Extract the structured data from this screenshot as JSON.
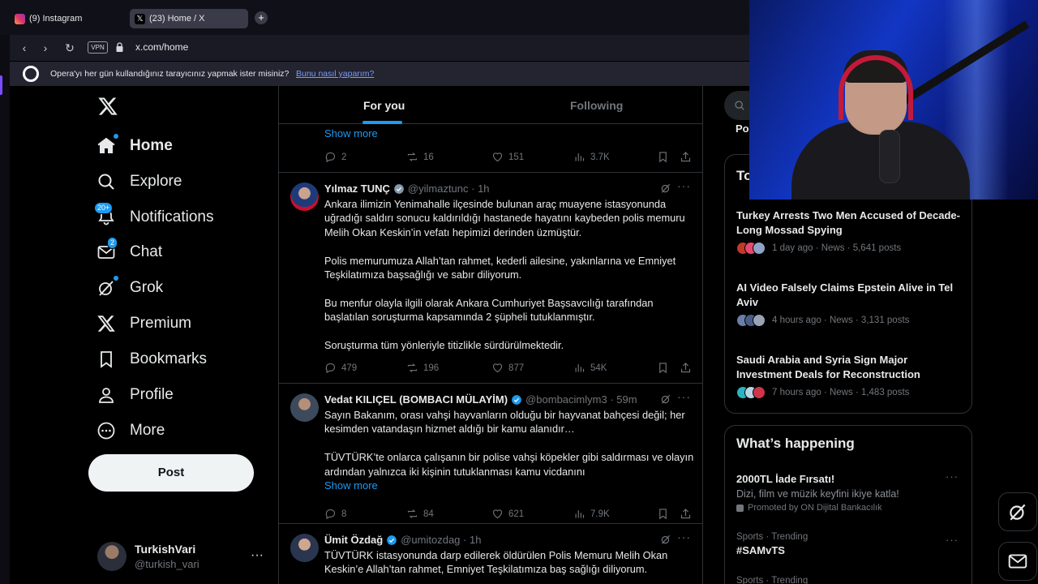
{
  "browser": {
    "tabs": [
      {
        "label": "(9) Instagram",
        "active": false
      },
      {
        "label": "(23) Home / X",
        "active": true
      }
    ],
    "url": "x.com/home",
    "vpn_label": "VPN",
    "opera_prompt": "Opera'yı her gün kullandığınız tarayıcınız yapmak ister misiniz?",
    "opera_link": "Bunu nasıl yaparım?"
  },
  "nav": {
    "items": [
      {
        "label": "Home",
        "icon": "home-icon",
        "badge": ""
      },
      {
        "label": "Explore",
        "icon": "search-icon",
        "badge": ""
      },
      {
        "label": "Notifications",
        "icon": "bell-icon",
        "badge": "20+"
      },
      {
        "label": "Chat",
        "icon": "mail-icon",
        "badge": "2"
      },
      {
        "label": "Grok",
        "icon": "grok-icon",
        "badge": ""
      },
      {
        "label": "Premium",
        "icon": "x-icon",
        "badge": ""
      },
      {
        "label": "Bookmarks",
        "icon": "bookmark-icon",
        "badge": ""
      },
      {
        "label": "Profile",
        "icon": "person-icon",
        "badge": ""
      },
      {
        "label": "More",
        "icon": "more-circle-icon",
        "badge": ""
      }
    ],
    "post_label": "Post",
    "account": {
      "name": "TurkishVari",
      "handle": "@turkish_vari",
      "more": "···"
    }
  },
  "timeline": {
    "tabs": [
      "For you",
      "Following"
    ],
    "active_tab": "For you",
    "first_partial": {
      "show_more": "Show more",
      "stats": {
        "replies": "2",
        "reposts": "16",
        "likes": "151",
        "views": "3.7K"
      }
    },
    "tweets": [
      {
        "name": "Yılmaz TUNÇ",
        "handle": "@yilmaztunc",
        "time": "1h",
        "paragraphs": [
          "Ankara ilimizin Yenimahalle ilçesinde bulunan araç muayene istasyonunda uğradığı saldırı sonucu kaldırıldığı hastanede hayatını kaybeden polis memuru Melih Okan Keskin’in vefatı hepimizi derinden üzmüştür.",
          "Polis memurumuza Allah’tan rahmet, kederli ailesine, yakınlarına ve Emniyet Teşkilatımıza başsağlığı ve sabır diliyorum.",
          "Bu menfur olayla ilgili olarak Ankara Cumhuriyet Başsavcılığı tarafından başlatılan soruşturma kapsamında 2 şüpheli tutuklanmıştır.",
          "Soruşturma tüm yönleriyle titizlikle sürdürülmektedir."
        ],
        "show_more": "",
        "stats": {
          "replies": "479",
          "reposts": "196",
          "likes": "877",
          "views": "54K"
        }
      },
      {
        "name": "Vedat KILIÇEL (BOMBACI MÜLAYİM)",
        "handle": "@bombacimlym3",
        "time": "59m",
        "paragraphs": [
          "Sayın Bakanım, orası vahşi hayvanların olduğu bir hayvanat bahçesi değil; her kesimden vatandaşın hizmet aldığı bir kamu alanıdır…",
          "TÜVTÜRK’te onlarca çalışanın bir polise vahşi köpekler gibi saldırması ve olayın ardından yalnızca iki kişinin tutuklanması kamu vicdanını"
        ],
        "show_more": "Show more",
        "stats": {
          "replies": "8",
          "reposts": "84",
          "likes": "621",
          "views": "7.9K"
        }
      },
      {
        "name": "Ümit Özdağ",
        "handle": "@umitozdag",
        "time": "1h",
        "paragraphs": [
          "TÜVTÜRK istasyonunda darp edilerek öldürülen Polis Memuru Melih Okan Keskin’e Allah’tan rahmet, Emniyet Teşkilatımıza baş sağlığı diliyorum."
        ],
        "show_more": "",
        "stats": {
          "replies": "",
          "reposts": "",
          "likes": "",
          "views": ""
        }
      }
    ]
  },
  "sidebar": {
    "search_partial": "Po",
    "news_header_partial": "To",
    "news": [
      {
        "title": "Turkey Arrests Two Men Accused of Decade-Long Mossad Spying",
        "meta": "1 day ago · News · 5,641 posts",
        "colors": [
          "#c0392b",
          "#e84a6f",
          "#8ea3c7"
        ]
      },
      {
        "title": "AI Video Falsely Claims Epstein Alive in Tel Aviv",
        "meta": "4 hours ago · News · 3,131 posts",
        "colors": [
          "#6b7ea8",
          "#4a5d86",
          "#9aa3b5"
        ]
      },
      {
        "title": "Saudi Arabia and Syria Sign Major Investment Deals for Reconstruction",
        "meta": "7 hours ago · News · 1,483 posts",
        "colors": [
          "#2bb3c0",
          "#b8d4e6",
          "#d0344a"
        ]
      }
    ],
    "happening_title": "What’s happening",
    "trends": [
      {
        "category": "",
        "name": "2000TL İade Fırsatı!",
        "desc": "Dizi, film ve müzik keyfini ikiye katla!",
        "promo": "Promoted by ON Dijital Bankacılık"
      },
      {
        "category": "Sports · Trending",
        "name": "#SAMvTS",
        "desc": "",
        "promo": ""
      },
      {
        "category": "Sports · Trending",
        "name": "",
        "desc": "",
        "promo": ""
      }
    ]
  },
  "colors": {
    "accent": "#1d9bf0",
    "border": "#2f3336",
    "muted": "#71767b",
    "text": "#e7e9ea"
  }
}
